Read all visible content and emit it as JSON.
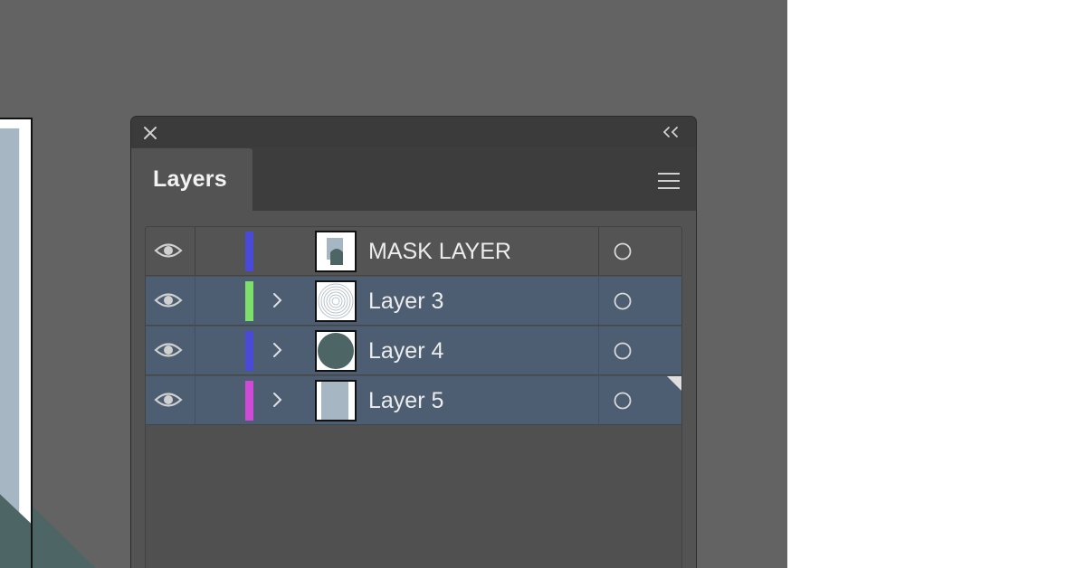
{
  "panel": {
    "tab_label": "Layers",
    "icons": {
      "close": "close-icon",
      "collapse": "collapse-double-chevron-icon",
      "menu": "hamburger-menu-icon"
    }
  },
  "layers": [
    {
      "name": "MASK LAYER",
      "color": "#4a4ad8",
      "selected": false,
      "expandable": false,
      "thumbnail": "mask-thumbnail"
    },
    {
      "name": "Layer 3",
      "color": "#7de06a",
      "selected": true,
      "expandable": true,
      "thumbnail": "concentric-circles-thumbnail"
    },
    {
      "name": "Layer 4",
      "color": "#4a4ad8",
      "selected": true,
      "expandable": true,
      "thumbnail": "circle-thumbnail"
    },
    {
      "name": "Layer 5",
      "color": "#d04ad8",
      "selected": true,
      "expandable": true,
      "thumbnail": "rectangle-thumbnail"
    }
  ],
  "colors": {
    "workspace": "#636363",
    "panel_bg": "#535353",
    "selected_row": "#4d5e72",
    "accent_slate": "#a6b6c2",
    "accent_teal": "#4e6566"
  }
}
